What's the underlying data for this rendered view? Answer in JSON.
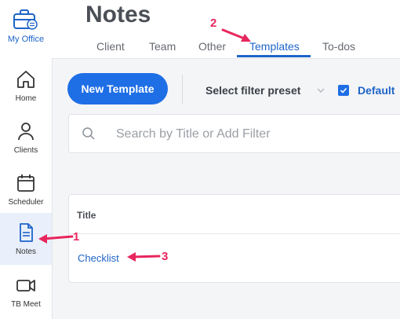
{
  "app": {
    "brand_label": "My Office"
  },
  "sidebar": {
    "items": [
      {
        "label": "Home",
        "icon": "home-icon"
      },
      {
        "label": "Clients",
        "icon": "person-icon"
      },
      {
        "label": "Scheduler",
        "icon": "calendar-icon"
      },
      {
        "label": "Notes",
        "icon": "document-icon",
        "active": true
      },
      {
        "label": "TB Meet",
        "icon": "video-camera-icon"
      }
    ]
  },
  "header": {
    "title": "Notes",
    "tabs": [
      {
        "label": "Client"
      },
      {
        "label": "Team"
      },
      {
        "label": "Other"
      },
      {
        "label": "Templates",
        "active": true
      },
      {
        "label": "To-dos"
      }
    ]
  },
  "toolbar": {
    "new_button_label": "New Template",
    "filter_preset_label": "Select filter preset",
    "default_label": "Default",
    "default_checked": true
  },
  "search": {
    "placeholder": "Search by Title or Add Filter",
    "value": ""
  },
  "table": {
    "columns": [
      "Title"
    ],
    "rows": [
      {
        "title": "Checklist"
      }
    ]
  },
  "annotations": {
    "one": "1",
    "two": "2",
    "three": "3"
  },
  "colors": {
    "accent": "#1e6ee6",
    "annotation": "#e8265e",
    "active_nav_bg": "#e9f0fb"
  }
}
